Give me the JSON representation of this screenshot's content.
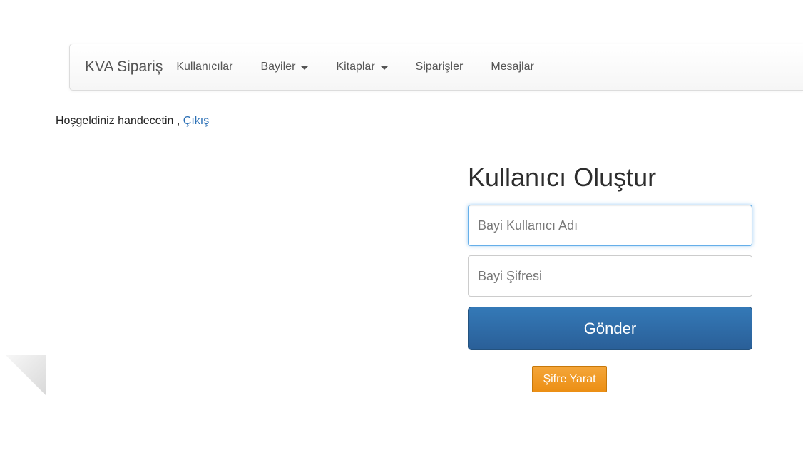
{
  "navbar": {
    "brand": "KVA Sipariş",
    "items": [
      {
        "label": "Kullanıcılar",
        "dropdown": false
      },
      {
        "label": "Bayiler",
        "dropdown": true
      },
      {
        "label": "Kitaplar",
        "dropdown": true
      },
      {
        "label": "Siparişler",
        "dropdown": false
      },
      {
        "label": "Mesajlar",
        "dropdown": false
      }
    ]
  },
  "welcome": {
    "text": "Hoşgeldiniz handecetin , ",
    "logout_label": "Çıkış"
  },
  "form": {
    "title": "Kullanıcı Oluştur",
    "username_placeholder": "Bayi Kullanıcı Adı",
    "password_placeholder": "Bayi Şifresi",
    "submit_label": "Gönder",
    "generate_password_label": "Şifre Yarat"
  },
  "colors": {
    "link": "#2a6fb5",
    "primary_button": "#2d6aa6",
    "warning_button": "#f09a22",
    "focus_border": "#66afe9"
  }
}
